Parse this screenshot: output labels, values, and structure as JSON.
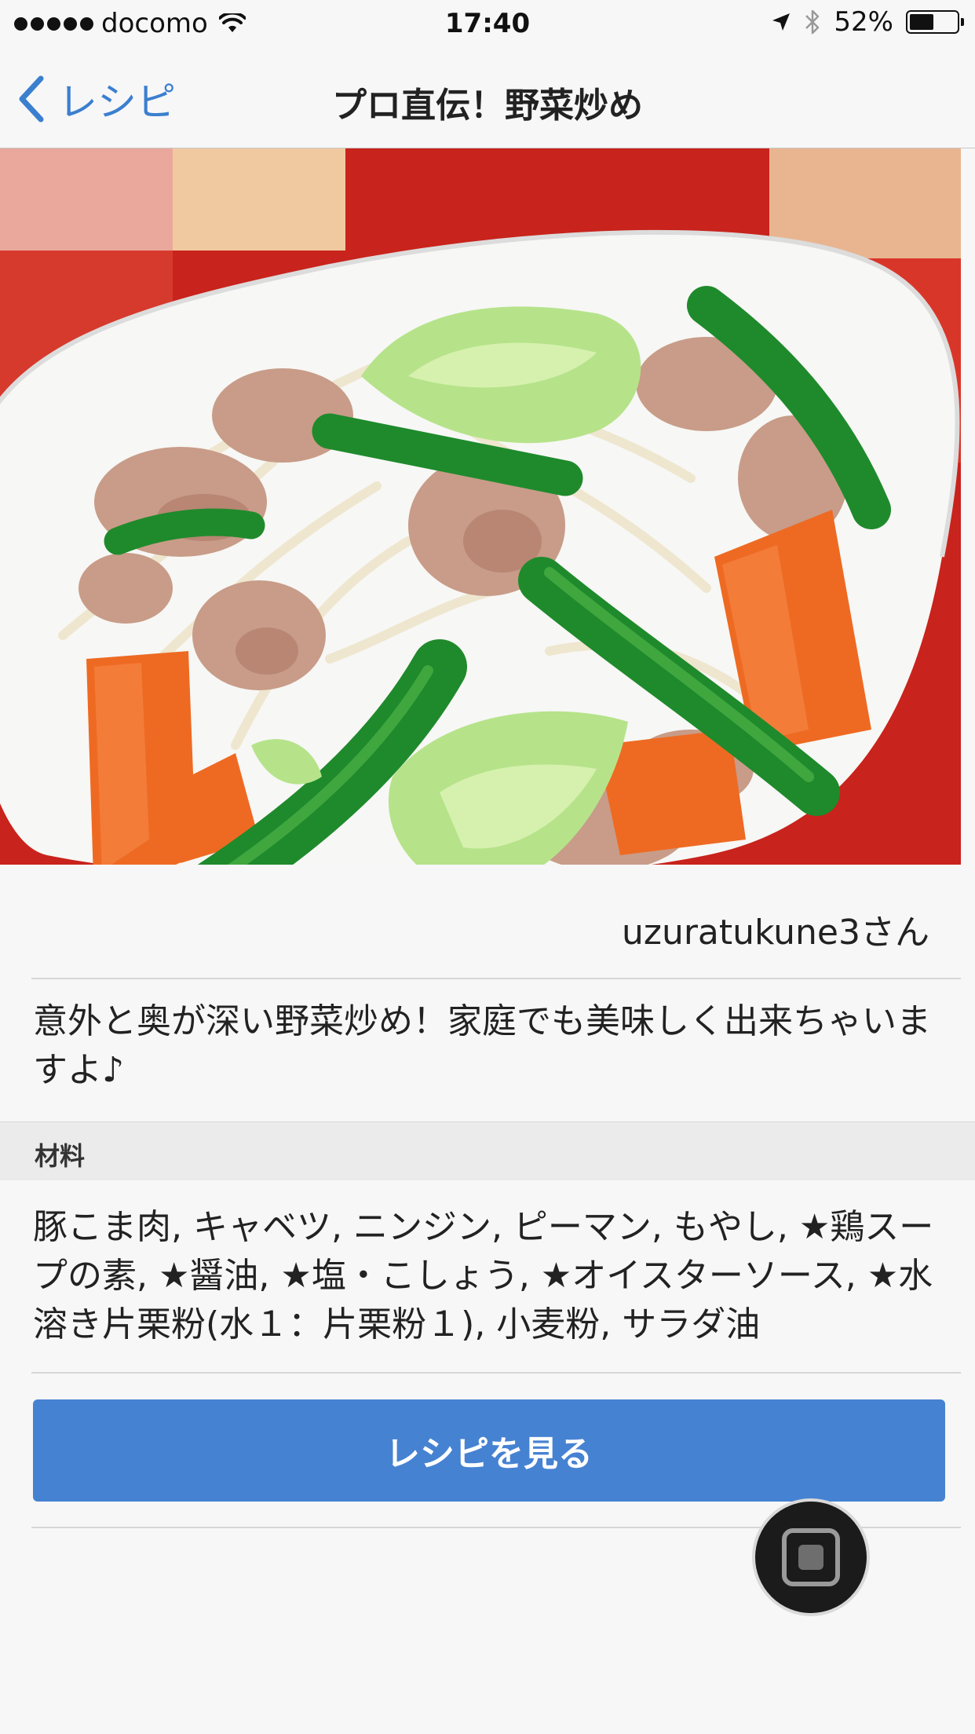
{
  "status_bar": {
    "carrier": "docomo",
    "time": "17:40",
    "battery": "52%",
    "battery_level": 0.52,
    "icons": [
      "signal-dots-icon",
      "wifi-icon",
      "location-arrow-icon",
      "bluetooth-icon",
      "battery-icon"
    ]
  },
  "nav": {
    "back_label": "レシピ",
    "title": "プロ直伝！野菜炒め"
  },
  "recipe": {
    "author": "uzuratukune3さん",
    "description": "意外と奥が深い野菜炒め！家庭でも美味しく出来ちゃいますよ♪",
    "ingredients_header": "材料",
    "ingredients": "豚こま肉, キャベツ, ニンジン, ピーマン, もやし, ★鶏スープの素, ★醤油, ★塩・こしょう, ★オイスターソース, ★水溶き片栗粉(水１：片栗粉１), 小麦粉, サラダ油",
    "cta_label": "レシピを見る"
  },
  "colors": {
    "accent": "#3b7fcf",
    "button": "#4682d2",
    "background": "#f7f7f7",
    "section_header": "#ebebeb"
  }
}
